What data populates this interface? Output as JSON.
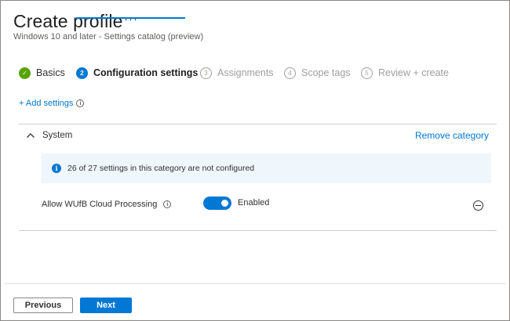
{
  "header": {
    "title": "Create profile",
    "more_glyph": "···",
    "subtitle": "Windows 10 and later - Settings catalog (preview)"
  },
  "steps": [
    {
      "number": "✓",
      "label": "Basics",
      "state": "done"
    },
    {
      "number": "2",
      "label": "Configuration settings",
      "state": "current"
    },
    {
      "number": "3",
      "label": "Assignments",
      "state": "future"
    },
    {
      "number": "4",
      "label": "Scope tags",
      "state": "future"
    },
    {
      "number": "5",
      "label": "Review + create",
      "state": "future"
    }
  ],
  "add_settings": {
    "label": "+ Add settings",
    "info_glyph": "i"
  },
  "category": {
    "name": "System",
    "expanded": true,
    "remove_label": "Remove category",
    "banner": {
      "icon": "info-icon",
      "info_glyph": "i",
      "text": "26 of 27 settings in this category are not configured"
    }
  },
  "setting": {
    "label": "Allow WUfB Cloud Processing",
    "info_glyph": "i",
    "toggle_on": true,
    "toggle_label": "Enabled"
  },
  "footer": {
    "previous_label": "Previous",
    "next_label": "Next"
  },
  "colors": {
    "accent": "#0078d4",
    "success": "#57a300",
    "banner_bg": "#eff6fc"
  }
}
